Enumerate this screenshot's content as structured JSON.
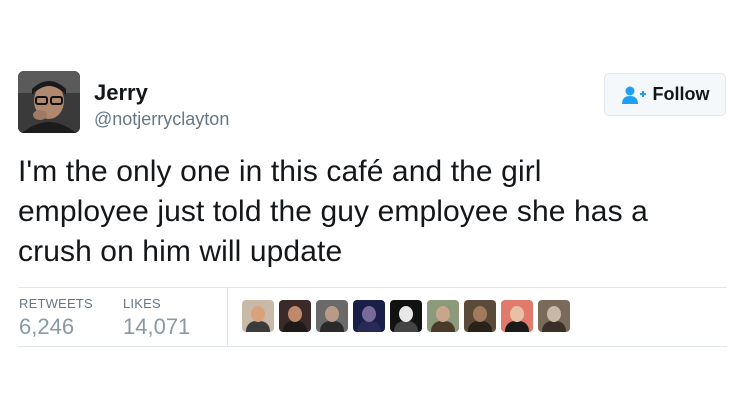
{
  "author": {
    "name": "Jerry",
    "handle": "@notjerryclayton",
    "avatar_icon": "user-avatar"
  },
  "follow_button": {
    "label": "Follow",
    "icon": "add-user-icon",
    "accent": "#1da1f2"
  },
  "tweet": {
    "text_lines": [
      "I'm the only one in this café and the girl",
      "employee just told the guy employee she has a",
      "crush on him will update"
    ]
  },
  "stats": {
    "retweets_label": "RETWEETS",
    "retweets_value": "6,246",
    "likes_label": "LIKES",
    "likes_value": "14,071"
  },
  "likers": [
    {
      "bg": "#c9b9a8",
      "face": "#d9a27b",
      "body": "#3b3b3b"
    },
    {
      "bg": "#3a2a2a",
      "face": "#c08a6a",
      "body": "#1f1a1a"
    },
    {
      "bg": "#6a6a6a",
      "face": "#b89a86",
      "body": "#2a2a2a"
    },
    {
      "bg": "#1a1f4a",
      "face": "#7a6a9a",
      "body": "#262a55"
    },
    {
      "bg": "#121212",
      "face": "#e8e8e8",
      "body": "#444444"
    },
    {
      "bg": "#8a9a7a",
      "face": "#c9a58a",
      "body": "#4a3a2a"
    },
    {
      "bg": "#5a4a3a",
      "face": "#a07a5a",
      "body": "#2a2218"
    },
    {
      "bg": "#e07a6a",
      "face": "#e8c0a8",
      "body": "#1a1a1a"
    },
    {
      "bg": "#7a6a5a",
      "face": "#c8b8a8",
      "body": "#3a3028"
    }
  ]
}
